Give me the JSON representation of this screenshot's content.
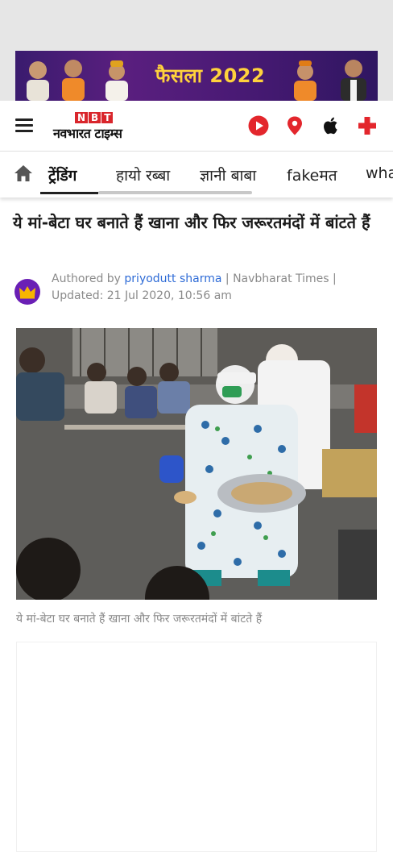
{
  "ad_banner": {
    "text": "फैसला 2022"
  },
  "header": {
    "logo_badge": [
      "N",
      "B",
      "T"
    ],
    "logo_name": "नवभारत टाइम्स",
    "icons": [
      "menu-icon",
      "play-icon",
      "location-pin-icon",
      "apple-icon",
      "plus-icon"
    ],
    "brand_color": "#d9262c"
  },
  "nav": {
    "items": [
      "ट्रेंडिंग",
      "हायो रब्बा",
      "ज्ञानी बाबा",
      "fakeमत",
      "wha"
    ],
    "active_index": 0
  },
  "article": {
    "headline": "ये मां-बेटा घर बनाते हैं खाना और फिर जरूरतमंदों में बांटते हैं",
    "byline_prefix": "Authored by",
    "author": "priyodutt sharma",
    "separator": "|",
    "publication": "Navbharat Times",
    "updated": "Updated: 21 Jul 2020, 10:56 am",
    "image_caption": "ये मां-बेटा घर बनाते हैं खाना और फिर जरूरतमंदों में बांटते हैं"
  },
  "colors": {
    "author_link": "#2e6bd6",
    "avatar_bg": "#6a1fb5",
    "ad_text": "#ffd23c"
  }
}
